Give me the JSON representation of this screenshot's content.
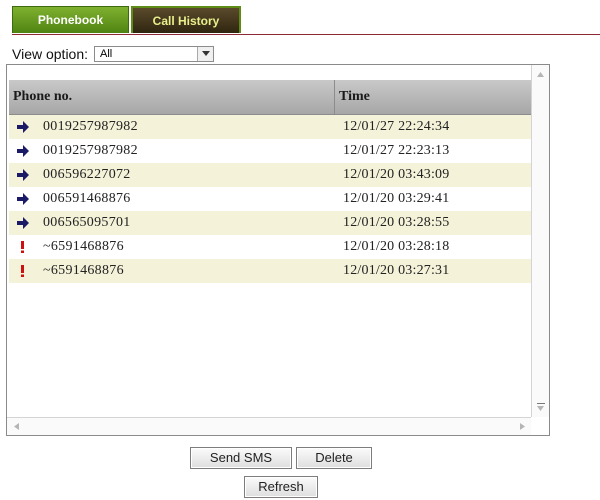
{
  "tabs": [
    {
      "label": "Phonebook",
      "active": false
    },
    {
      "label": "Call History",
      "active": true
    }
  ],
  "view_option": {
    "label": "View option:",
    "selected": "All"
  },
  "table": {
    "columns": [
      "Phone no.",
      "Time"
    ],
    "rows": [
      {
        "icon": "outgoing-call-icon",
        "phone": "0019257987982",
        "time": "12/01/27 22:24:34"
      },
      {
        "icon": "outgoing-call-icon",
        "phone": "0019257987982",
        "time": "12/01/27 22:23:13"
      },
      {
        "icon": "outgoing-call-icon",
        "phone": "006596227072",
        "time": "12/01/20 03:43:09"
      },
      {
        "icon": "outgoing-call-icon",
        "phone": "006591468876",
        "time": "12/01/20 03:29:41"
      },
      {
        "icon": "outgoing-call-icon",
        "phone": "006565095701",
        "time": "12/01/20 03:28:55"
      },
      {
        "icon": "missed-call-icon",
        "phone": "~6591468876",
        "time": "12/01/20 03:28:18"
      },
      {
        "icon": "missed-call-icon",
        "phone": "~6591468876",
        "time": "12/01/20 03:27:31"
      }
    ]
  },
  "buttons": {
    "send_sms": "Send SMS",
    "delete": "Delete",
    "refresh": "Refresh"
  },
  "colors": {
    "rule": "#8b2a35",
    "row_alt": "#f4f2d9",
    "outgoing_arrow": "#1a1a66",
    "missed_mark": "#cc1111"
  }
}
